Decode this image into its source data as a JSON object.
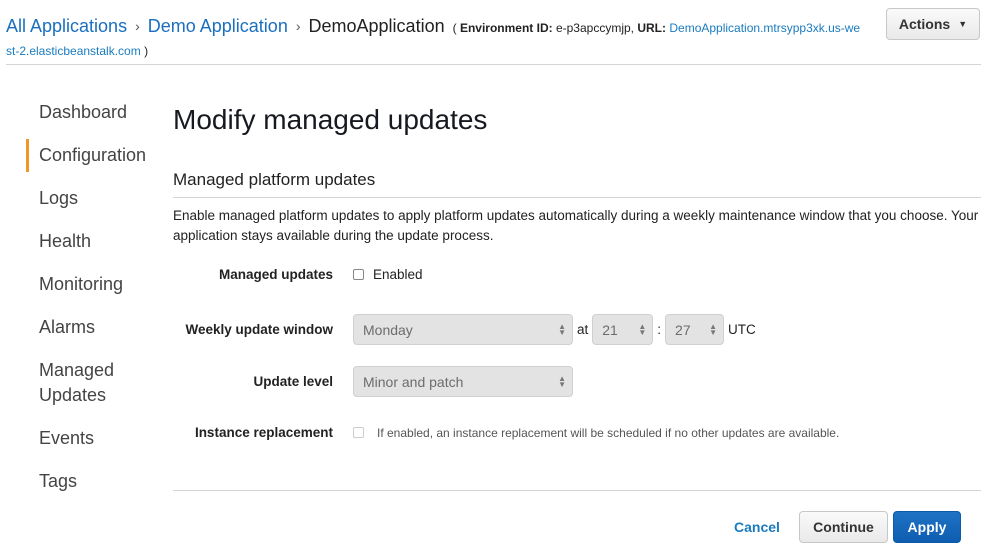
{
  "header": {
    "breadcrumbs": [
      {
        "label": "All Applications",
        "link": true
      },
      {
        "label": "Demo Application",
        "link": true
      },
      {
        "label": "DemoApplication",
        "link": false
      }
    ],
    "separator": "›",
    "env_open": "(",
    "env_id_label": "Environment ID:",
    "env_id_value": "e-p3apccymjp,",
    "url_label": "URL:",
    "url_part1": "DemoApplication.mtrsypp3xk.us-we",
    "url_part2": "st-2.elasticbeanstalk.com",
    "env_close": ")",
    "actions_label": "Actions",
    "actions_icon": "caret-down-icon"
  },
  "sidebar": {
    "items": [
      {
        "label": "Dashboard",
        "active": false
      },
      {
        "label": "Configuration",
        "active": true
      },
      {
        "label": "Logs",
        "active": false
      },
      {
        "label": "Health",
        "active": false
      },
      {
        "label": "Monitoring",
        "active": false
      },
      {
        "label": "Alarms",
        "active": false
      },
      {
        "label": "Managed Updates",
        "active": false
      },
      {
        "label": "Events",
        "active": false
      },
      {
        "label": "Tags",
        "active": false
      }
    ],
    "active_color": "#f0962a"
  },
  "main": {
    "title": "Modify managed updates",
    "section_title": "Managed platform updates",
    "section_desc": "Enable managed platform updates to apply platform updates automatically during a weekly maintenance window that you choose. Your application stays available during the update process.",
    "fields": {
      "managed_updates": {
        "label": "Managed updates",
        "checkbox_label": "Enabled",
        "checked": false
      },
      "weekly_window": {
        "label": "Weekly update window",
        "day": "Monday",
        "at_text": "at",
        "hour": "21",
        "colon": ":",
        "minute": "27",
        "tz": "UTC"
      },
      "update_level": {
        "label": "Update level",
        "value": "Minor and patch"
      },
      "instance_replacement": {
        "label": "Instance replacement",
        "checked": false,
        "hint": "If enabled, an instance replacement will be scheduled if no other updates are available."
      }
    }
  },
  "footer": {
    "cancel_label": "Cancel",
    "continue_label": "Continue",
    "apply_label": "Apply"
  },
  "colors": {
    "link": "#1a6fbf",
    "primary_button": "#1166bb",
    "accent": "#f0962a"
  }
}
